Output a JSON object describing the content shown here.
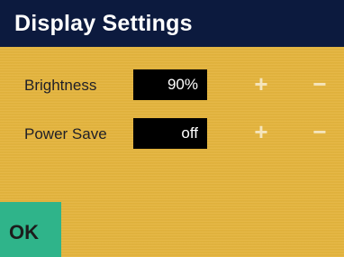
{
  "header": {
    "title": "Display Settings"
  },
  "settings": [
    {
      "label": "Brightness",
      "value": "90%",
      "plus": "+",
      "minus": "−"
    },
    {
      "label": "Power Save",
      "value": "off",
      "plus": "+",
      "minus": "−"
    }
  ],
  "footer": {
    "ok_label": "OK"
  },
  "colors": {
    "background": "#e4b43c",
    "title_bar": "#0c1a3e",
    "value_box": "#000000",
    "ok_button": "#2fb48a"
  }
}
